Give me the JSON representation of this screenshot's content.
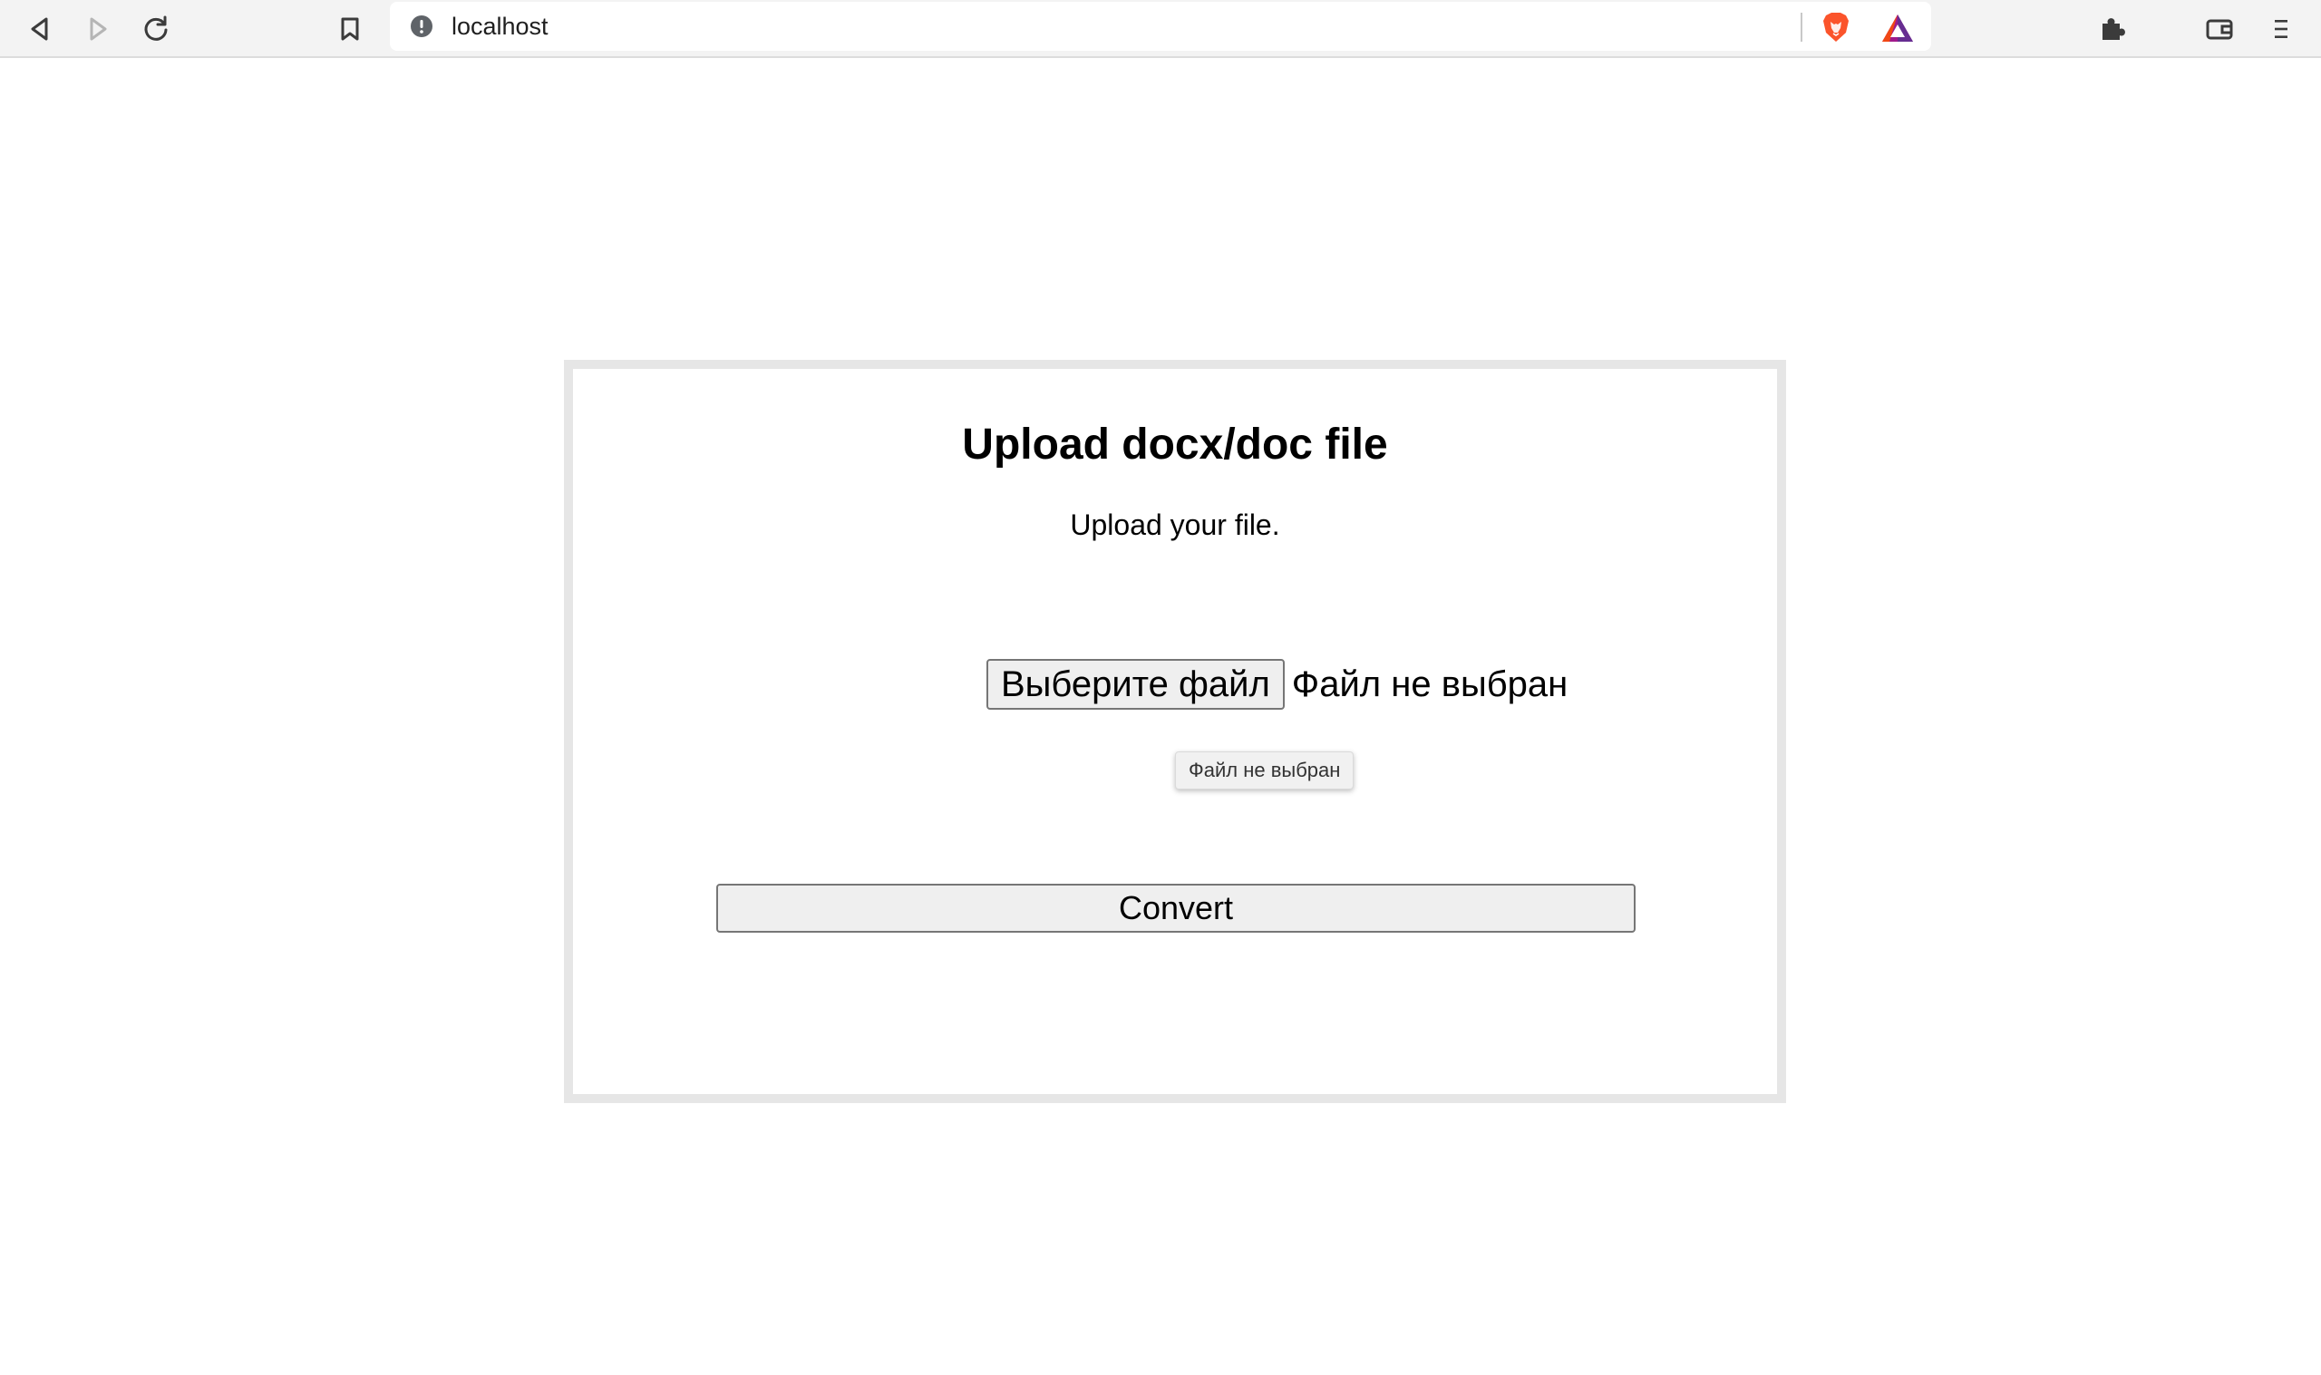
{
  "browser": {
    "url": "localhost",
    "icons": {
      "back": "back-arrow-icon",
      "forward": "forward-arrow-icon",
      "reload": "reload-icon",
      "bookmark": "bookmark-icon",
      "site_info": "info-icon",
      "brave_shields": "brave-lion-icon",
      "rewards": "bat-triangle-icon",
      "extensions": "puzzle-icon",
      "wallet": "wallet-icon",
      "menu": "hamburger-menu-icon"
    },
    "colors": {
      "toolbar_bg": "#f3f3f3",
      "brave_orange": "#fb542b",
      "bat_purple": "#662d91"
    }
  },
  "page": {
    "title": "Upload docx/doc file",
    "subtitle": "Upload your file.",
    "file_input": {
      "button_label": "Выберите файл",
      "status": "Файл не выбран",
      "tooltip": "Файл не выбран"
    },
    "convert_label": "Convert",
    "colors": {
      "card_border": "#e6e6e6",
      "button_bg": "#efefef",
      "button_border": "#767676"
    }
  }
}
